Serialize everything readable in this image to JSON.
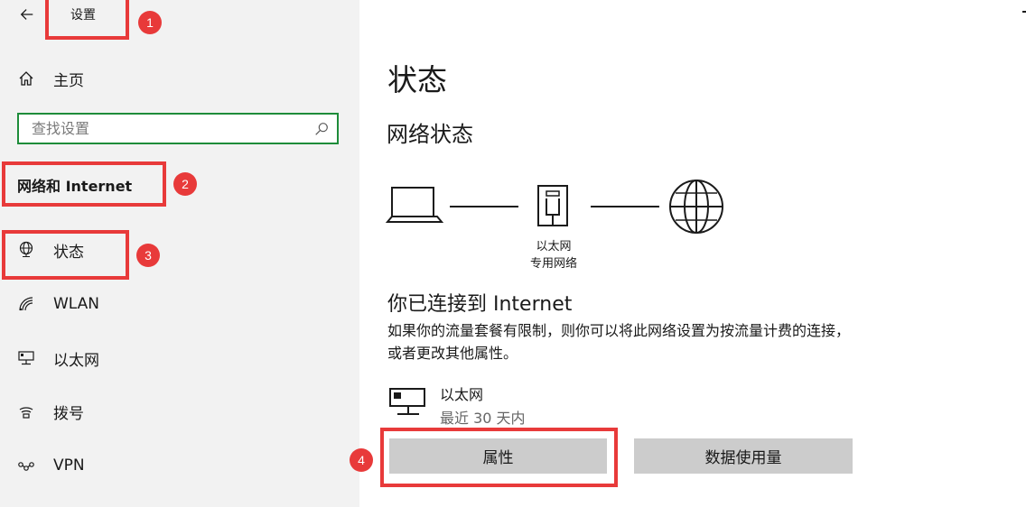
{
  "window": {
    "title": "设置"
  },
  "sidebar": {
    "home_label": "主页",
    "search": {
      "placeholder": "查找设置",
      "value": ""
    },
    "section_heading": "网络和 Internet",
    "items": [
      {
        "label": "状态",
        "icon": "globe-monitor-icon"
      },
      {
        "label": "WLAN",
        "icon": "wifi-icon"
      },
      {
        "label": "以太网",
        "icon": "ethernet-icon"
      },
      {
        "label": "拨号",
        "icon": "dialup-icon"
      },
      {
        "label": "VPN",
        "icon": "vpn-icon"
      }
    ]
  },
  "main": {
    "title": "状态",
    "network_status_heading": "网络状态",
    "diagram": {
      "device_label_line1": "以太网",
      "device_label_line2": "专用网络"
    },
    "connection_title": "你已连接到 Internet",
    "connection_description": "如果你的流量套餐有限制，则你可以将此网络设置为按流量计费的连接，或者更改其他属性。",
    "adapter": {
      "name": "以太网",
      "usage": "最近 30 天内"
    },
    "buttons": {
      "properties": "属性",
      "data_usage": "数据使用量"
    }
  },
  "annotations": {
    "badges": [
      "1",
      "2",
      "3",
      "4"
    ],
    "color": "#e83a3a"
  },
  "colors": {
    "sidebar_bg": "#f2f2f2",
    "search_border": "#1e8c3a",
    "button_bg": "#cccccc"
  }
}
